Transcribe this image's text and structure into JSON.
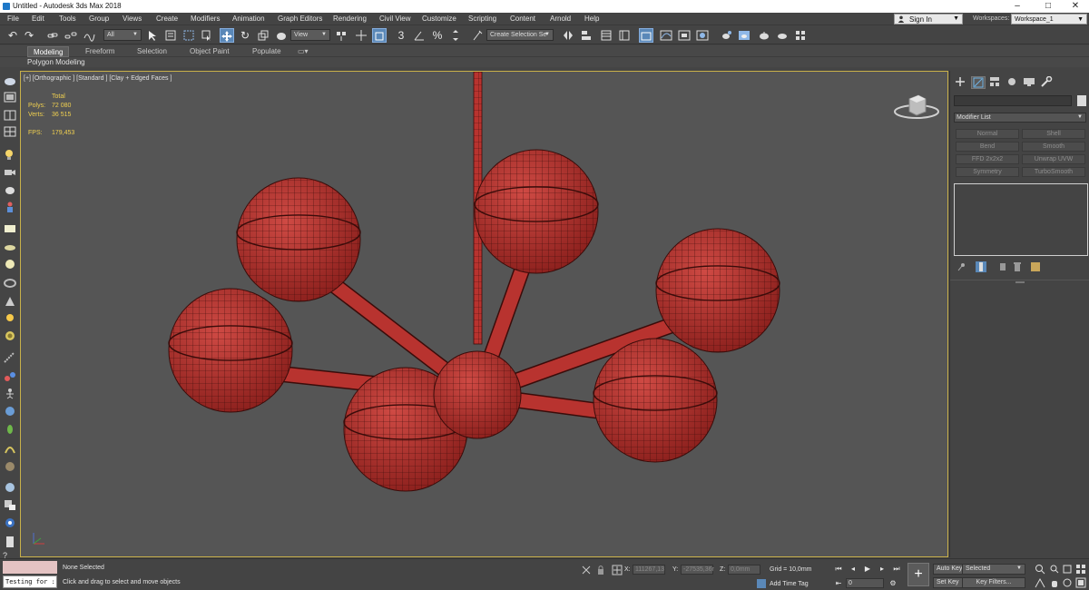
{
  "window": {
    "title": "Untitled - Autodesk 3ds Max 2018",
    "controls": [
      "–",
      "□",
      "✕"
    ]
  },
  "menu": {
    "items": [
      "File",
      "Edit",
      "Tools",
      "Group",
      "Views",
      "Create",
      "Modifiers",
      "Animation",
      "Graph Editors",
      "Rendering",
      "Civil View",
      "Customize",
      "Scripting",
      "Content",
      "Arnold",
      "Help"
    ],
    "signin": "Sign In",
    "workspaces_label": "Workspaces:",
    "workspace_value": "Workspace_1"
  },
  "toolbar": {
    "filter_value": "All",
    "ref_coord_value": "View",
    "named_selection_value": "Create Selection Se",
    "snap_value": "3"
  },
  "ribbon": {
    "tabs": [
      "Modeling",
      "Freeform",
      "Selection",
      "Object Paint",
      "Populate"
    ],
    "active_tab": "Modeling",
    "sub_label": "Polygon Modeling"
  },
  "viewport": {
    "label": "[+] [Orthographic ] [Standard ] [Clay + Edged Faces ]",
    "stats": {
      "total_label": "Total",
      "polys_label": "Polys:",
      "polys_value": "72 080",
      "verts_label": "Verts:",
      "verts_value": "36 515",
      "fps_label": "FPS:",
      "fps_value": "179,453"
    },
    "mesh_color": "#b8332f",
    "wire_color": "#3a0c0a"
  },
  "command_panel": {
    "modifier_list": "Modifier List",
    "modifier_buttons": [
      "Normal",
      "Shell",
      "Bend",
      "Smooth",
      "FFD 2x2x2",
      "Unwrap UVW",
      "Symmetry",
      "TurboSmooth"
    ]
  },
  "status": {
    "selection": "None Selected",
    "prompt": "Click and drag to select and move objects",
    "maxscript": "Testing for :",
    "x_label": "X:",
    "x_value": "111267,13",
    "y_label": "Y:",
    "y_value": "-27535,36r",
    "z_label": "Z:",
    "z_value": "0,0mm",
    "grid": "Grid = 10,0mm",
    "add_time_tag": "Add Time Tag",
    "frame_value": "0",
    "auto_key": "Auto Key",
    "set_key": "Set Key",
    "key_mode": "Selected",
    "key_filters": "Key Filters..."
  }
}
